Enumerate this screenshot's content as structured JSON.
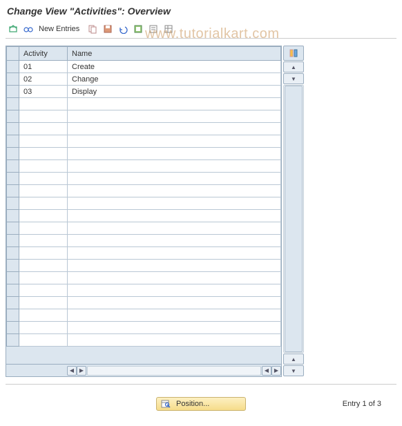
{
  "title": "Change View \"Activities\": Overview",
  "watermark": "www.tutorialkart.com",
  "toolbar": {
    "new_entries": "New Entries"
  },
  "table": {
    "columns": {
      "activity": "Activity",
      "name": "Name"
    },
    "rows": [
      {
        "activity": "01",
        "name": "Create"
      },
      {
        "activity": "02",
        "name": "Change"
      },
      {
        "activity": "03",
        "name": "Display"
      },
      {
        "activity": "",
        "name": ""
      },
      {
        "activity": "",
        "name": ""
      },
      {
        "activity": "",
        "name": ""
      },
      {
        "activity": "",
        "name": ""
      },
      {
        "activity": "",
        "name": ""
      },
      {
        "activity": "",
        "name": ""
      },
      {
        "activity": "",
        "name": ""
      },
      {
        "activity": "",
        "name": ""
      },
      {
        "activity": "",
        "name": ""
      },
      {
        "activity": "",
        "name": ""
      },
      {
        "activity": "",
        "name": ""
      },
      {
        "activity": "",
        "name": ""
      },
      {
        "activity": "",
        "name": ""
      },
      {
        "activity": "",
        "name": ""
      },
      {
        "activity": "",
        "name": ""
      },
      {
        "activity": "",
        "name": ""
      },
      {
        "activity": "",
        "name": ""
      },
      {
        "activity": "",
        "name": ""
      },
      {
        "activity": "",
        "name": ""
      },
      {
        "activity": "",
        "name": ""
      }
    ]
  },
  "footer": {
    "position_label": "Position...",
    "entry_text": "Entry 1 of 3"
  }
}
